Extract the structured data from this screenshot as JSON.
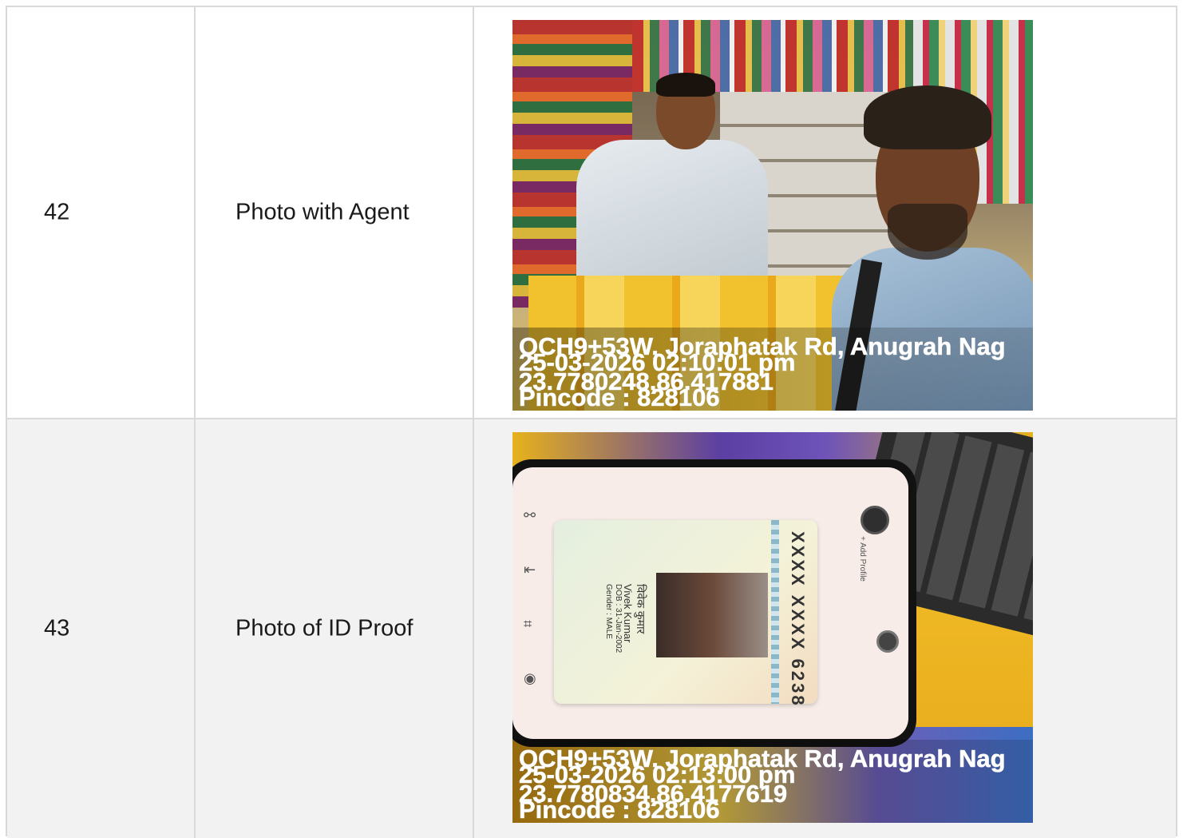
{
  "rows": [
    {
      "number": "42",
      "label": "Photo with Agent",
      "photo": {
        "geotag": {
          "address": "QCH9+53W, Joraphatak Rd, Anugrah Nag",
          "datetime": "25-03-2026 02:10:01 pm",
          "coordinates": "23.7780248,86.417881",
          "pincode": "Pincode : 828106"
        }
      }
    },
    {
      "number": "43",
      "label": "Photo of ID Proof",
      "photo": {
        "id_card": {
          "number": "XXXX XXXX 6238",
          "name_hindi": "विवेक कुमार",
          "name": "Vivek Kumar",
          "dob": "DOB : 31-Jan-2002",
          "gender": "Gender : MALE"
        },
        "phone_ui": {
          "add_profile": "+ Add Profile"
        },
        "geotag": {
          "address": "QCH9+53W, Joraphatak Rd, Anugrah Nag",
          "datetime": "25-03-2026 02:13:00 pm",
          "coordinates": "23.7780834,86.4177619",
          "pincode": "Pincode : 828106"
        }
      }
    }
  ]
}
